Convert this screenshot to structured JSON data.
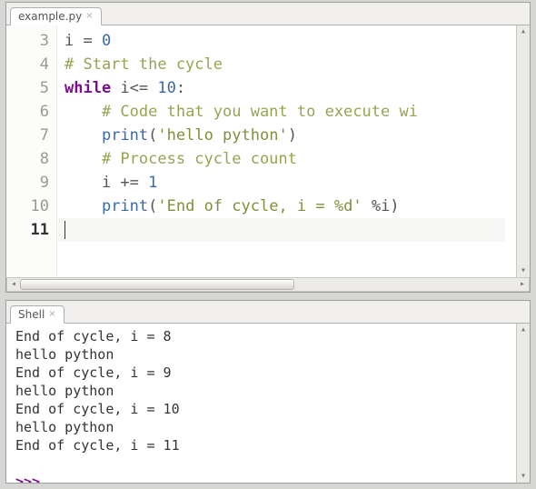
{
  "editor": {
    "tab_label": "example.py",
    "first_visible_line": 3,
    "current_line": 11,
    "lines": [
      {
        "n": 3,
        "tokens": [
          {
            "t": "i ",
            "c": "op"
          },
          {
            "t": "= ",
            "c": "op"
          },
          {
            "t": "0",
            "c": "num"
          }
        ]
      },
      {
        "n": 4,
        "tokens": [
          {
            "t": "# Start the cycle",
            "c": "com"
          }
        ]
      },
      {
        "n": 5,
        "tokens": [
          {
            "t": "while",
            "c": "kw"
          },
          {
            "t": " i",
            "c": "op"
          },
          {
            "t": "<= ",
            "c": "op"
          },
          {
            "t": "10",
            "c": "num"
          },
          {
            "t": ":",
            "c": "op"
          }
        ]
      },
      {
        "n": 6,
        "tokens": [
          {
            "t": "    ",
            "c": "op"
          },
          {
            "t": "# Code that you want to execute wi",
            "c": "com"
          }
        ]
      },
      {
        "n": 7,
        "tokens": [
          {
            "t": "    ",
            "c": "op"
          },
          {
            "t": "print",
            "c": "fn"
          },
          {
            "t": "(",
            "c": "op"
          },
          {
            "t": "'hello python'",
            "c": "str"
          },
          {
            "t": ")",
            "c": "op"
          }
        ]
      },
      {
        "n": 8,
        "tokens": [
          {
            "t": "    ",
            "c": "op"
          },
          {
            "t": "# Process cycle count",
            "c": "com"
          }
        ]
      },
      {
        "n": 9,
        "tokens": [
          {
            "t": "    i ",
            "c": "op"
          },
          {
            "t": "+= ",
            "c": "op"
          },
          {
            "t": "1",
            "c": "num"
          }
        ]
      },
      {
        "n": 10,
        "tokens": [
          {
            "t": "    ",
            "c": "op"
          },
          {
            "t": "print",
            "c": "fn"
          },
          {
            "t": "(",
            "c": "op"
          },
          {
            "t": "'End of cycle, i = %d'",
            "c": "str"
          },
          {
            "t": " ",
            "c": "op"
          },
          {
            "t": "%",
            "c": "op"
          },
          {
            "t": "i)",
            "c": "op"
          }
        ]
      },
      {
        "n": 11,
        "tokens": [
          {
            "t": "",
            "c": "op"
          }
        ]
      }
    ]
  },
  "shell": {
    "tab_label": "Shell",
    "output": [
      "End of cycle, i = 8",
      "hello python",
      "End of cycle, i = 9",
      "hello python",
      "End of cycle, i = 10",
      "hello python",
      "End of cycle, i = 11"
    ],
    "prompt": ">>> "
  }
}
